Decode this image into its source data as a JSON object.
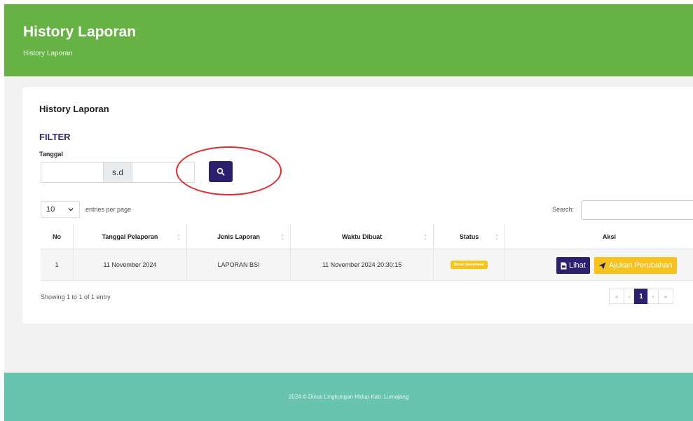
{
  "header": {
    "title": "History Laporan",
    "breadcrumb": "History Laporan",
    "bg_color": "#66b245"
  },
  "card": {
    "title": "History Laporan",
    "filter": {
      "title": "FILTER",
      "date_label": "Tanggal",
      "from_value": "",
      "range_separator": "s.d",
      "to_value": "",
      "search_button_icon": "search-icon"
    }
  },
  "table_controls": {
    "entries_value": "10",
    "entries_label": "entries per page",
    "search_label": "Search:",
    "search_value": ""
  },
  "table": {
    "columns": [
      "No",
      "Tanggal Pelaporan",
      "Jenis Laporan",
      "Waktu Dibuat",
      "Status",
      "Aksi"
    ],
    "rows": [
      {
        "no": "1",
        "tanggal": "11 November 2024",
        "jenis": "LAPORAN BSI",
        "waktu": "11 November 2024 20:30:15",
        "status": "Belum Diverifikasi",
        "actions": {
          "view_label": "Lihat",
          "edit_label": "Ajukan Perubahan"
        }
      }
    ]
  },
  "info": "Showing 1 to 1 of 1 entry",
  "pagination": {
    "first": "«",
    "prev": "‹",
    "current": "1",
    "next": "›",
    "last": "»"
  },
  "footer": {
    "text": "2024 © Dinas Lingkungan Hidup Kab. Lumajang",
    "bg_color": "#68c4ae"
  },
  "colors": {
    "primary": "#2d1f6e",
    "warning": "#f7c21b",
    "annotation": "#e12a2a"
  }
}
